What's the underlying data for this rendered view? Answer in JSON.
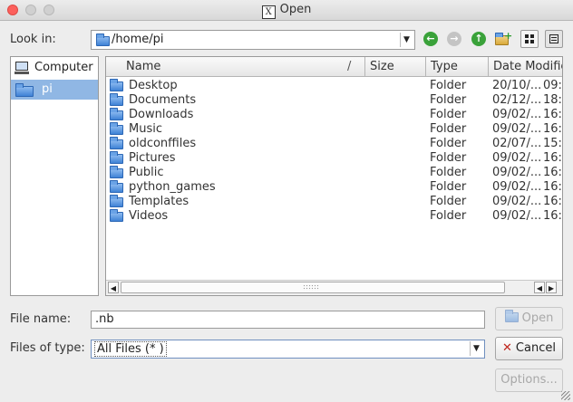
{
  "window": {
    "title": "Open",
    "title_icon_glyph": "X"
  },
  "toolbar": {
    "look_in_label": "Look in:",
    "path": "/home/pi",
    "back_icon": "back-arrow-icon",
    "forward_icon": "forward-arrow-icon",
    "up_icon": "parent-directory-icon",
    "new_folder_icon": "new-folder-icon",
    "list_view_icon": "list-view-icon",
    "detail_view_icon": "detail-view-icon"
  },
  "sidebar": {
    "items": [
      {
        "label": "Computer",
        "icon": "computer-icon",
        "selected": false
      },
      {
        "label": "pi",
        "icon": "folder-icon",
        "selected": true
      }
    ]
  },
  "file_list": {
    "columns": [
      "Name",
      "Size",
      "Type",
      "Date Modified"
    ],
    "rows": [
      {
        "name": "Desktop",
        "type": "Folder",
        "date": "20/10/...",
        "time": "09:"
      },
      {
        "name": "Documents",
        "type": "Folder",
        "date": "02/12/...",
        "time": "18:"
      },
      {
        "name": "Downloads",
        "type": "Folder",
        "date": "09/02/...",
        "time": "16:"
      },
      {
        "name": "Music",
        "type": "Folder",
        "date": "09/02/...",
        "time": "16:"
      },
      {
        "name": "oldconffiles",
        "type": "Folder",
        "date": "02/07/...",
        "time": "15:"
      },
      {
        "name": "Pictures",
        "type": "Folder",
        "date": "09/02/...",
        "time": "16:"
      },
      {
        "name": "Public",
        "type": "Folder",
        "date": "09/02/...",
        "time": "16:"
      },
      {
        "name": "python_games",
        "type": "Folder",
        "date": "09/02/...",
        "time": "16:"
      },
      {
        "name": "Templates",
        "type": "Folder",
        "date": "09/02/...",
        "time": "16:"
      },
      {
        "name": "Videos",
        "type": "Folder",
        "date": "09/02/...",
        "time": "16:"
      }
    ]
  },
  "bottom": {
    "file_name_label": "File name:",
    "file_name_value": ".nb",
    "file_type_label": "Files of type:",
    "file_type_value": "All Files (* )",
    "open_label": "Open",
    "cancel_label": "Cancel",
    "options_label": "Options..."
  },
  "colors": {
    "selection": "#90b7e4",
    "close_button": "#fc605c",
    "nav_green": "#3aa23a"
  }
}
